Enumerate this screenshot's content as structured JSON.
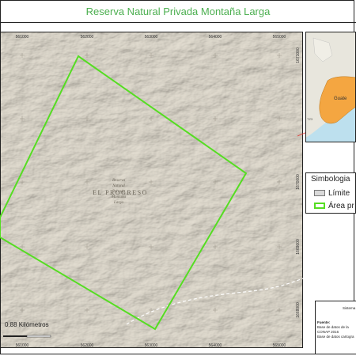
{
  "title": "Reserva Natural Privada Montaña Larga",
  "map": {
    "place_label": "EL PROGRESO",
    "reserve_label_lines": [
      "Reserva",
      "Natural",
      "Privada",
      "Montaña",
      "Larga"
    ],
    "x_ticks_top": [
      "561000",
      "562000",
      "563000",
      "564000",
      "565000"
    ],
    "x_ticks_bottom": [
      "561000",
      "562000",
      "563000",
      "564000",
      "565000"
    ],
    "y_ticks_right": [
      "1671000",
      "1670000",
      "1669000",
      "1668000"
    ],
    "scale_label": "0.88 Kilómetros",
    "colors": {
      "terrain": "#dcd6c9",
      "boundary": "#55dd22",
      "road": "#ffffff"
    }
  },
  "inset": {
    "labels": [
      "Guate",
      "TZ3"
    ],
    "colors": {
      "department": "#f4a641",
      "water": "#bde0ee",
      "land": "#e8e6dd",
      "pointer": "#e53935"
    }
  },
  "legend": {
    "title": "Simbologia",
    "items": [
      {
        "label": "Límite",
        "swatch": "#d9d9d9"
      },
      {
        "label": "Área pr",
        "swatch": "#55dd22"
      }
    ]
  },
  "info": {
    "header": "Sistema",
    "source_title": "Fuente:",
    "lines": [
      "Base de datos de la",
      "CONAP 2016",
      "Base de datos cartogra"
    ]
  }
}
